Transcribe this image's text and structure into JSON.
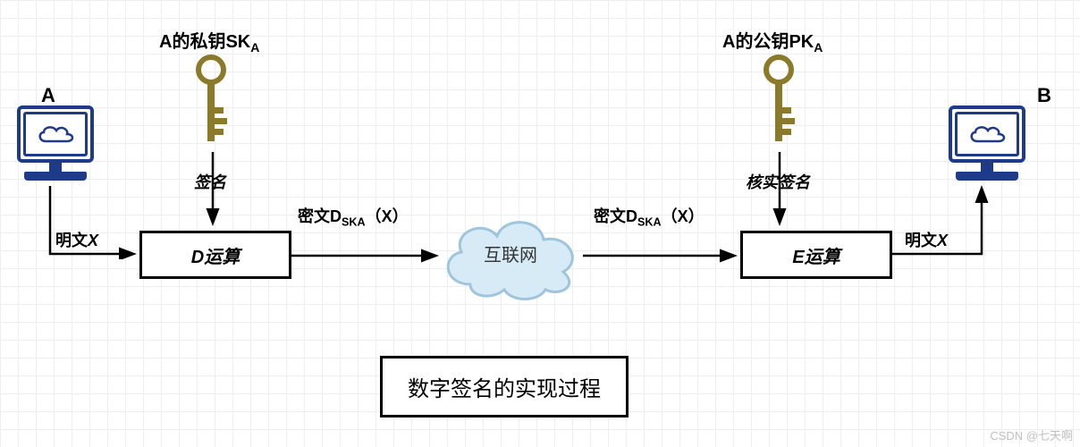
{
  "labels": {
    "A": "A",
    "B": "B",
    "private_key": "A的私钥SK",
    "private_key_sub": "A",
    "public_key": "A的公钥PK",
    "public_key_sub": "A",
    "sign": "签名",
    "verify": "核实签名",
    "plaintext1_prefix": "明文",
    "plaintext1_x": "X",
    "d_op": "D运算",
    "cipher1_prefix": "密文D",
    "cipher1_sub": "SKA",
    "cipher1_suffix": "（X）",
    "internet": "互联网",
    "cipher2_prefix": "密文D",
    "cipher2_sub": "SKA",
    "cipher2_suffix": "（X）",
    "e_op": "E运算",
    "plaintext2_prefix": "明文",
    "plaintext2_x": "X",
    "title": "数字签名的实现过程",
    "watermark": "CSDN @七天啊"
  }
}
